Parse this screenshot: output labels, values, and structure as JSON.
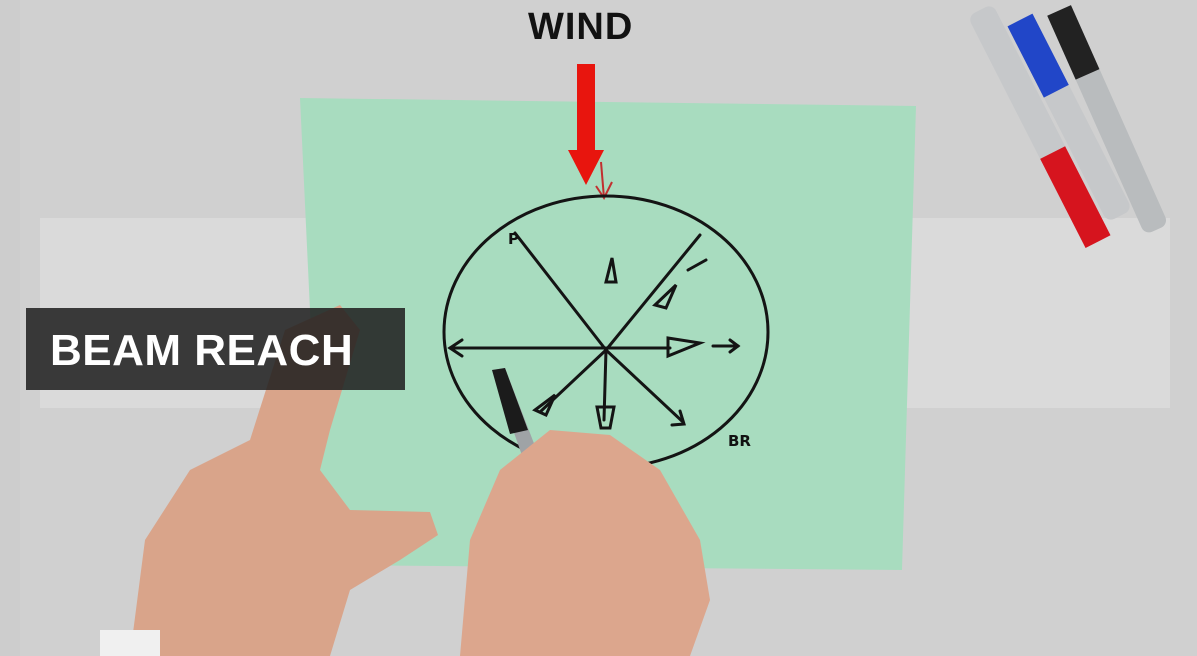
{
  "overlay": {
    "wind_label": "WIND",
    "caption": "BEAM REACH"
  },
  "drawing": {
    "label_bottom_right": "BR",
    "label_top_left": "P"
  },
  "colors": {
    "paper": "#a8dcbf",
    "wind_arrow": "#e8150e",
    "ink": "#141414",
    "caption_bg": "#1e1e1e"
  },
  "icons": [
    "wind-arrow-icon",
    "marker-icon"
  ]
}
